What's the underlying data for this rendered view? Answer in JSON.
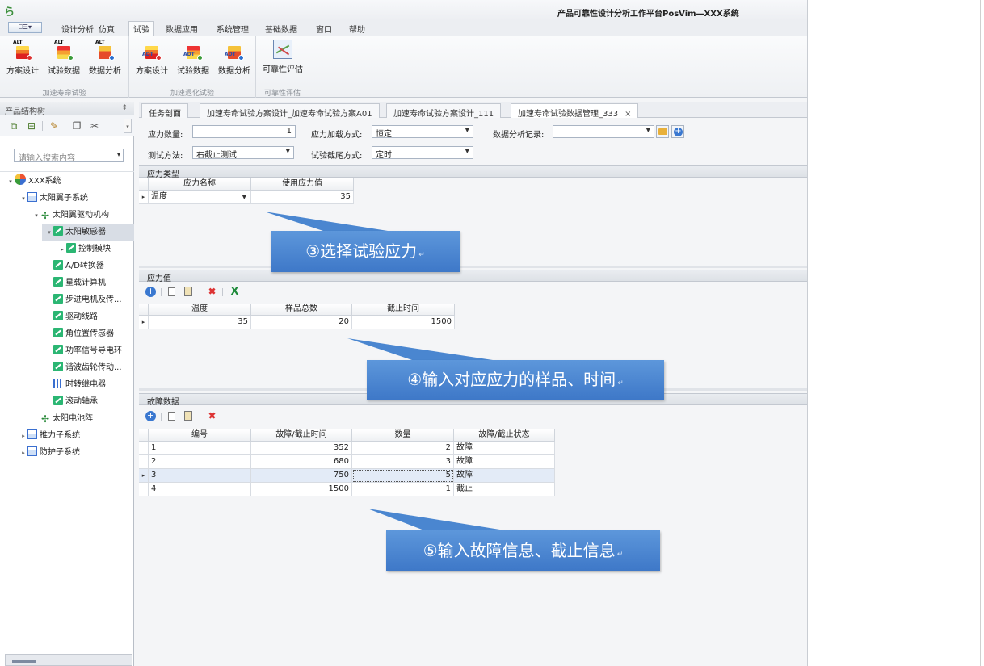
{
  "titlebar": {
    "logo": "ら",
    "title": "产品可靠性设计分析工作平台PosVim—XXX系统"
  },
  "menu": {
    "app_button": "⎕☰▾",
    "tabs": [
      "设计分析",
      "仿真",
      "试验",
      "数据应用",
      "系统管理",
      "基础数据",
      "窗口",
      "帮助"
    ],
    "active_tab": "试验"
  },
  "ribbon": {
    "groups": [
      {
        "label": "加速寿命试验",
        "buttons": [
          "方案设计",
          "试验数据",
          "数据分析"
        ],
        "icon_tag": "ALT"
      },
      {
        "label": "加速退化试验",
        "buttons": [
          "方案设计",
          "试验数据",
          "数据分析"
        ],
        "icon_tag": "ADT"
      },
      {
        "label": "可靠性评估",
        "buttons": [
          "可靠性评估"
        ]
      }
    ]
  },
  "left_panel": {
    "title": "产品结构树",
    "pin": "⇞",
    "search_placeholder": "请输入搜索内容",
    "tree": [
      {
        "label": "XXX系统",
        "level": 0,
        "toggle": "▾",
        "icon": "sys"
      },
      {
        "label": "太阳翼子系统",
        "level": 1,
        "toggle": "▾",
        "icon": "sub"
      },
      {
        "label": "太阳翼驱动机构",
        "level": 2,
        "toggle": "▾",
        "icon": "mech"
      },
      {
        "label": "太阳敏感器",
        "level": 3,
        "toggle": "▾",
        "icon": "part",
        "selected": true
      },
      {
        "label": "控制模块",
        "level": 4,
        "toggle": "▸",
        "icon": "part"
      },
      {
        "label": "A/D转换器",
        "level": 3,
        "toggle": "",
        "icon": "part"
      },
      {
        "label": "星载计算机",
        "level": 3,
        "toggle": "",
        "icon": "part"
      },
      {
        "label": "步进电机及传...",
        "level": 3,
        "toggle": "",
        "icon": "part"
      },
      {
        "label": "驱动线路",
        "level": 3,
        "toggle": "",
        "icon": "part"
      },
      {
        "label": "角位置传感器",
        "level": 3,
        "toggle": "",
        "icon": "part"
      },
      {
        "label": "功率信号导电环",
        "level": 3,
        "toggle": "",
        "icon": "part"
      },
      {
        "label": "谐波齿轮传动...",
        "level": 3,
        "toggle": "",
        "icon": "part"
      },
      {
        "label": "时转继电器",
        "level": 3,
        "toggle": "",
        "icon": "relay"
      },
      {
        "label": "滚动轴承",
        "level": 3,
        "toggle": "",
        "icon": "part"
      },
      {
        "label": "太阳电池阵",
        "level": 2,
        "toggle": "",
        "icon": "mech"
      },
      {
        "label": "推力子系统",
        "level": 1,
        "toggle": "▸",
        "icon": "sub"
      },
      {
        "label": "防护子系统",
        "level": 1,
        "toggle": "▸",
        "icon": "sub"
      }
    ]
  },
  "doc_tabs": {
    "tabs": [
      "任务剖面",
      "加速寿命试验方案设计_加速寿命试验方案A01",
      "加速寿命试验方案设计_111",
      "加速寿命试验数据管理_333"
    ],
    "active_index": 3,
    "close_glyph": "×"
  },
  "form": {
    "stress_count_label": "应力数量:",
    "stress_count_value": "1",
    "stress_load_label": "应力加载方式:",
    "stress_load_value": "恒定",
    "analysis_record_label": "数据分析记录:",
    "analysis_record_value": "",
    "test_method_label": "测试方法:",
    "test_method_value": "右截止测试",
    "censor_label": "试验截尾方式:",
    "censor_value": "定时"
  },
  "stress_type": {
    "section_title": "应力类型",
    "columns": [
      "应力名称",
      "使用应力值"
    ],
    "rows": [
      {
        "name": "温度",
        "value": "35"
      }
    ]
  },
  "stress_values": {
    "section_title": "应力值",
    "columns": [
      "温度",
      "样品总数",
      "截止时间"
    ],
    "rows": [
      {
        "temp": "35",
        "samples": "20",
        "cutoff": "1500"
      }
    ]
  },
  "failure_data": {
    "section_title": "故障数据",
    "columns": [
      "编号",
      "故障/截止时间",
      "数量",
      "故障/截止状态"
    ],
    "rows": [
      {
        "id": "1",
        "time": "352",
        "qty": "2",
        "status": "故障"
      },
      {
        "id": "2",
        "time": "680",
        "qty": "3",
        "status": "故障"
      },
      {
        "id": "3",
        "time": "750",
        "qty": "5",
        "status": "故障",
        "selected": true
      },
      {
        "id": "4",
        "time": "1500",
        "qty": "1",
        "status": "截止"
      }
    ]
  },
  "callouts": {
    "c3": "③选择试验应力",
    "c4": "④输入对应应力的样品、时间",
    "c5": "⑤输入故障信息、截止信息",
    "return_glyph": "↵"
  },
  "colors": {
    "callout": "#4a86d0",
    "selected_row": "#e3ebf7",
    "accent": "#3a78d0"
  }
}
